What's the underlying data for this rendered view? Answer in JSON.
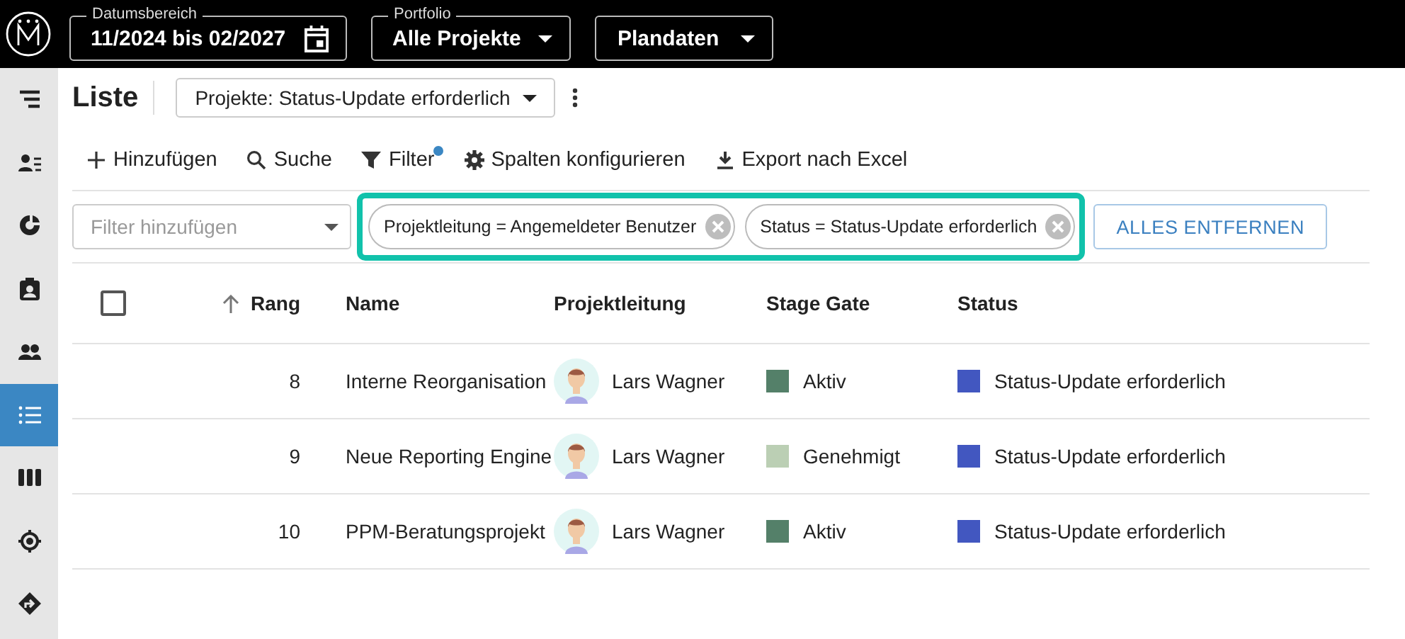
{
  "top_bar": {
    "fields": [
      {
        "kind": "date",
        "label": "Datumsbereich",
        "value": "11/2024 bis 02/2027"
      },
      {
        "kind": "select",
        "label": "Portfolio",
        "value": "Alle Projekte"
      },
      {
        "kind": "select",
        "value": "Plandaten"
      }
    ]
  },
  "sidebar": {
    "items": [
      {
        "selected": false
      },
      {
        "selected": false
      },
      {
        "selected": false
      },
      {
        "selected": false
      },
      {
        "selected": false
      },
      {
        "selected": true
      },
      {
        "selected": false
      },
      {
        "selected": false
      },
      {
        "selected": false
      }
    ]
  },
  "header": {
    "title": "Liste",
    "view": "Projekte: Status-Update erforderlich"
  },
  "toolbar": [
    {
      "label": "Hinzufügen",
      "active": false
    },
    {
      "label": "Suche",
      "active": false
    },
    {
      "label": "Filter",
      "active": true
    },
    {
      "label": "Spalten konfigurieren",
      "active": false
    },
    {
      "label": "Export nach Excel",
      "active": false
    }
  ],
  "filter_bar": {
    "placeholder": "Filter hinzufügen",
    "highlighted": true,
    "chips": [
      {
        "label": "Projektleitung = Angemeldeter Benutzer"
      },
      {
        "label": "Status = Status-Update erforderlich"
      }
    ],
    "clear_button": "ALLES ENTFERNEN"
  },
  "table": {
    "select_all": {
      "checked": false
    },
    "columns": [
      "Rang",
      "Name",
      "Projektleitung",
      "Stage Gate",
      "Status"
    ],
    "rows": [
      {
        "rank": "8",
        "name": "Interne Reorganisation",
        "lead": "Lars Wagner",
        "stage": {
          "label": "Aktiv",
          "color": "#548069"
        },
        "status": {
          "label": "Status-Update erforderlich",
          "color": "#4257c0"
        }
      },
      {
        "rank": "9",
        "name": "Neue Reporting Engine",
        "lead": "Lars Wagner",
        "stage": {
          "label": "Genehmigt",
          "color": "#bbcfb4"
        },
        "status": {
          "label": "Status-Update erforderlich",
          "color": "#4257c0"
        }
      },
      {
        "rank": "10",
        "name": "PPM-Beratungsprojekt",
        "lead": "Lars Wagner",
        "stage": {
          "label": "Aktiv",
          "color": "#548069"
        },
        "status": {
          "label": "Status-Update erforderlich",
          "color": "#4257c0"
        }
      }
    ]
  }
}
